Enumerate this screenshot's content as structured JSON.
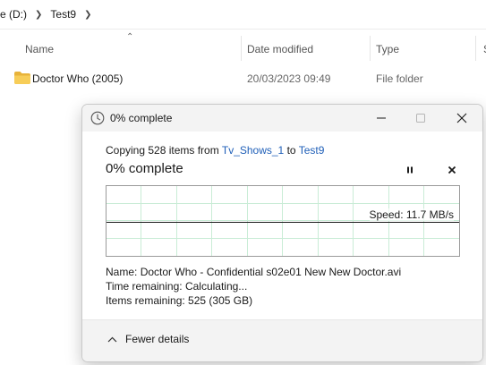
{
  "explorer": {
    "breadcrumb": {
      "drive": "e (D:)",
      "folder": "Test9"
    },
    "columns": {
      "name": "Name",
      "date_modified": "Date modified",
      "type": "Type",
      "size_partial": "S"
    },
    "files": [
      {
        "name": "Doctor Who (2005)",
        "date": "20/03/2023 09:49",
        "type": "File folder"
      }
    ]
  },
  "dialog": {
    "title": "0% complete",
    "copy_prefix": "Copying 528 items from",
    "source": "Tv_Shows_1",
    "copy_to": "to",
    "destination": "Test9",
    "status": "0% complete",
    "progress_percent": 0,
    "speed_text": "Speed: 11.7 MB/s",
    "name_label": "Name:",
    "name_value": "Doctor Who - Confidential s02e01 New New Doctor.avi",
    "time_label": "Time remaining:",
    "time_value": "Calculating...",
    "items_label": "Items remaining:",
    "items_value": "525 (305 GB)",
    "fewer_details": "Fewer details"
  },
  "colors": {
    "accent_link": "#1f5fb8",
    "graph_grid": "#c9ecd6",
    "folder": "#f2c94c"
  }
}
